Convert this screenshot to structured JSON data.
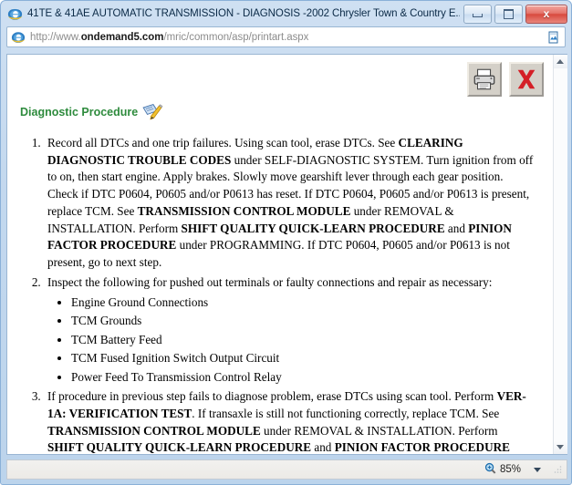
{
  "window": {
    "title": "41TE & 41AE AUTOMATIC TRANSMISSION - DIAGNOSIS -2002 Chrysler Town & Country E...",
    "minimize_label": "Minimize",
    "maximize_label": "Maximize",
    "close_label": "x"
  },
  "address_bar": {
    "url_protocol": "http://www.",
    "url_domain": "ondemand5.com",
    "url_path": "/mric/common/asp/printart.aspx",
    "full_url": "http://www.ondemand5.com/mric/common/asp/printart.aspx",
    "favicon": "internet-explorer-icon",
    "right_icon": "page-feed-icon"
  },
  "page_tools": {
    "print_label": "Print",
    "close_label": "Close"
  },
  "document": {
    "section_title": "Diagnostic Procedure",
    "section_icon": "notepad-pencil-icon",
    "steps": [
      {
        "html": "Record all DTCs and one trip failures. Using scan tool, erase DTCs. See <b>CLEARING DIAGNOSTIC TROUBLE CODES</b> under SELF-DIAGNOSTIC SYSTEM. Turn ignition from off to on, then start engine. Apply brakes. Slowly move gearshift lever through each gear position. Check if DTC P0604, P0605 and/or P0613 has reset. If DTC P0604, P0605 and/or P0613 is present, replace TCM. See <b>TRANSMISSION CONTROL MODULE</b> under REMOVAL &amp; INSTALLATION. Perform <b>SHIFT QUALITY QUICK-LEARN PROCEDURE</b> and <b>PINION FACTOR PROCEDURE</b> under PROGRAMMING. If DTC P0604, P0605 and/or P0613 is not present, go to next step."
      },
      {
        "html": "Inspect the following for pushed out terminals or faulty connections and repair as necessary:",
        "bullets": [
          "Engine Ground Connections",
          "TCM Grounds",
          "TCM Battery Feed",
          "TCM Fused Ignition Switch Output Circuit",
          "Power Feed To Transmission Control Relay"
        ]
      },
      {
        "html": "If procedure in previous step fails to diagnose problem, erase DTCs using scan tool. Perform <b>VER-1A: VERIFICATION TEST</b>. If transaxle is still not functioning correctly, replace TCM. See <b>TRANSMISSION CONTROL MODULE</b> under REMOVAL &amp; INSTALLATION. Perform <b>SHIFT QUALITY QUICK-LEARN PROCEDURE</b> and <b>PINION FACTOR PROCEDURE</b> under PROGRAMMING. If transaxle is functioning correctly, test is complete."
      }
    ]
  },
  "status_bar": {
    "message": "",
    "zoom_level": "85%",
    "zoom_icon": "magnifier-plus-icon"
  },
  "colors": {
    "section_title_green": "#2e8b3d",
    "close_red": "#d8493e",
    "chrome_blue": "#c3d8ee"
  }
}
